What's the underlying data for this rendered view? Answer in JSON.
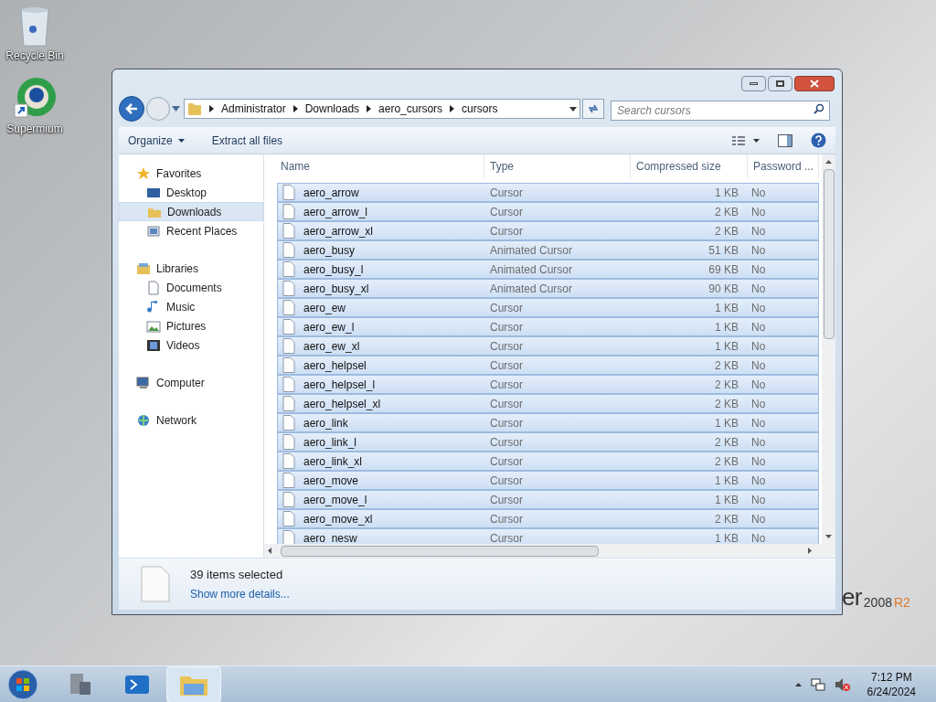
{
  "desktop_icons": [
    {
      "label": "Recycle Bin",
      "kind": "bin"
    },
    {
      "label": "Supermium",
      "kind": "browser"
    }
  ],
  "wallpaper_logo": {
    "word": "er",
    "version": "2008",
    "edition": "R2"
  },
  "address": {
    "crumbs": [
      "Administrator",
      "Downloads",
      "aero_cursors",
      "cursors"
    ]
  },
  "search": {
    "placeholder": "Search cursors"
  },
  "toolbar": [
    {
      "label": "Organize",
      "dropdown": true
    },
    {
      "label": "Extract all files",
      "dropdown": false
    }
  ],
  "nav": [
    {
      "label": "Favorites",
      "kind": "star",
      "selected": false,
      "children": [
        {
          "label": "Desktop",
          "kind": "desktop",
          "selected": false
        },
        {
          "label": "Downloads",
          "kind": "folder",
          "selected": true
        },
        {
          "label": "Recent Places",
          "kind": "recent",
          "selected": false
        }
      ]
    },
    {
      "label": "Libraries",
      "kind": "library",
      "selected": false,
      "children": [
        {
          "label": "Documents",
          "kind": "doc",
          "selected": false
        },
        {
          "label": "Music",
          "kind": "music",
          "selected": false
        },
        {
          "label": "Pictures",
          "kind": "pictures",
          "selected": false
        },
        {
          "label": "Videos",
          "kind": "videos",
          "selected": false
        }
      ]
    },
    {
      "label": "Computer",
      "kind": "computer",
      "selected": false
    },
    {
      "label": "Network",
      "kind": "network",
      "selected": false
    }
  ],
  "columns": [
    "Name",
    "Type",
    "Compressed size",
    "Password ..."
  ],
  "rows": [
    {
      "name": "aero_arrow",
      "type": "Cursor",
      "size": "1 KB",
      "password": "No",
      "selected": true
    },
    {
      "name": "aero_arrow_l",
      "type": "Cursor",
      "size": "2 KB",
      "password": "No",
      "selected": true
    },
    {
      "name": "aero_arrow_xl",
      "type": "Cursor",
      "size": "2 KB",
      "password": "No",
      "selected": true
    },
    {
      "name": "aero_busy",
      "type": "Animated Cursor",
      "size": "51 KB",
      "password": "No",
      "selected": true
    },
    {
      "name": "aero_busy_l",
      "type": "Animated Cursor",
      "size": "69 KB",
      "password": "No",
      "selected": true
    },
    {
      "name": "aero_busy_xl",
      "type": "Animated Cursor",
      "size": "90 KB",
      "password": "No",
      "selected": true
    },
    {
      "name": "aero_ew",
      "type": "Cursor",
      "size": "1 KB",
      "password": "No",
      "selected": true
    },
    {
      "name": "aero_ew_l",
      "type": "Cursor",
      "size": "1 KB",
      "password": "No",
      "selected": true
    },
    {
      "name": "aero_ew_xl",
      "type": "Cursor",
      "size": "1 KB",
      "password": "No",
      "selected": true
    },
    {
      "name": "aero_helpsel",
      "type": "Cursor",
      "size": "2 KB",
      "password": "No",
      "selected": true
    },
    {
      "name": "aero_helpsel_l",
      "type": "Cursor",
      "size": "2 KB",
      "password": "No",
      "selected": true
    },
    {
      "name": "aero_helpsel_xl",
      "type": "Cursor",
      "size": "2 KB",
      "password": "No",
      "selected": true
    },
    {
      "name": "aero_link",
      "type": "Cursor",
      "size": "1 KB",
      "password": "No",
      "selected": true
    },
    {
      "name": "aero_link_l",
      "type": "Cursor",
      "size": "2 KB",
      "password": "No",
      "selected": true
    },
    {
      "name": "aero_link_xl",
      "type": "Cursor",
      "size": "2 KB",
      "password": "No",
      "selected": true
    },
    {
      "name": "aero_move",
      "type": "Cursor",
      "size": "1 KB",
      "password": "No",
      "selected": true
    },
    {
      "name": "aero_move_l",
      "type": "Cursor",
      "size": "1 KB",
      "password": "No",
      "selected": true
    },
    {
      "name": "aero_move_xl",
      "type": "Cursor",
      "size": "2 KB",
      "password": "No",
      "selected": true
    },
    {
      "name": "aero_nesw",
      "type": "Cursor",
      "size": "1 KB",
      "password": "No",
      "selected": true
    }
  ],
  "details": {
    "summary": "39 items selected",
    "link": "Show more details..."
  },
  "taskbar": [
    {
      "kind": "server",
      "selected": false
    },
    {
      "kind": "powershell",
      "selected": false
    },
    {
      "kind": "explorer",
      "selected": true
    }
  ],
  "clock": {
    "time": "7:12 PM",
    "date": "6/24/2024"
  }
}
